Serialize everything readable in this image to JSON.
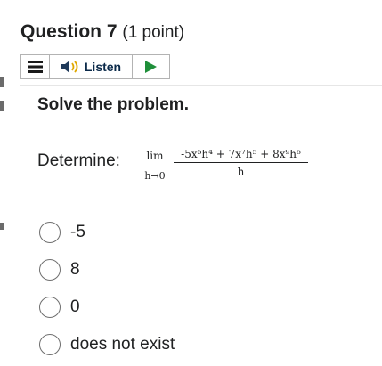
{
  "question": {
    "title": "Question 7",
    "points": "(1 point)"
  },
  "toolbar": {
    "listen_label": "Listen",
    "icons": [
      "menu-icon",
      "speaker-icon",
      "play-icon"
    ]
  },
  "instruction": "Solve the problem.",
  "prompt": {
    "label": "Determine:",
    "lim_word": "lim",
    "lim_sub": "h→0",
    "numerator": "-5x⁵h⁴ + 7x⁷h⁵ + 8x⁹h⁶",
    "denominator": "h"
  },
  "options": [
    {
      "label": "-5"
    },
    {
      "label": "8"
    },
    {
      "label": "0"
    },
    {
      "label": "does not exist"
    }
  ],
  "colors": {
    "text": "#202122",
    "play": "#1f8f3a",
    "speaker": "#1f3a5a",
    "border": "#b3b3b3"
  }
}
